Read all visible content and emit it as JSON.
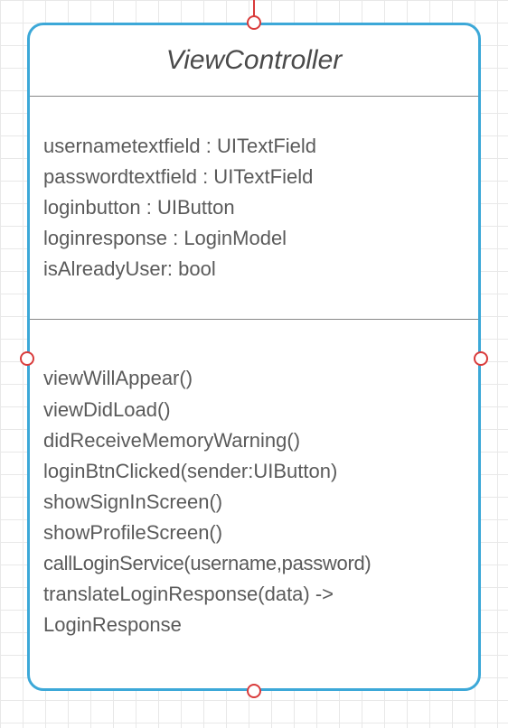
{
  "class": {
    "name": "ViewController",
    "attributes": [
      "usernametextfield  : UITextField",
      "passwordtextfield : UITextField",
      "loginbutton : UIButton",
      "loginresponse : LoginModel",
      "isAlreadyUser: bool"
    ],
    "methods": [
      "viewWillAppear()",
      "viewDidLoad()",
      "didReceiveMemoryWarning()",
      "loginBtnClicked(sender:UIButton)",
      "showSignInScreen()",
      "showProfileScreen()",
      "callLoginService(username,password)",
      "translateLoginResponse(data) ->",
      "LoginResponse"
    ]
  }
}
